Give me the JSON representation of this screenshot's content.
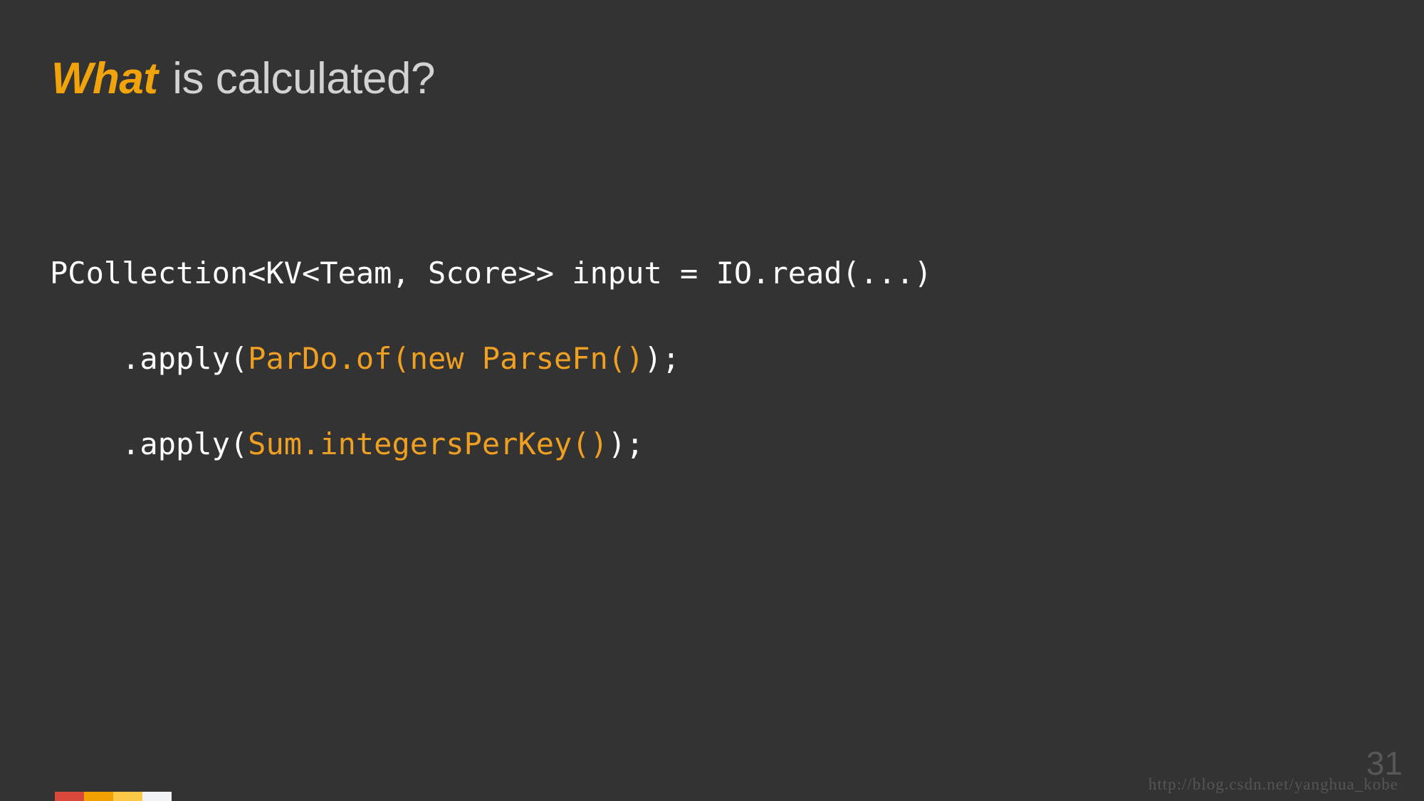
{
  "slide": {
    "background_color": "#333333",
    "title": {
      "accent_text": "What",
      "accent_color": "#F0A30A",
      "rest_text": " is calculated?",
      "rest_color": "#D2D2D2"
    },
    "code": {
      "language": "java",
      "plain_color": "#FFFFFF",
      "call_color": "#F0A020",
      "lines": [
        {
          "segments": [
            {
              "text": "PCollection<KV<Team, Score>> input = IO.read(...)",
              "style": "plain"
            }
          ]
        },
        {
          "segments": [
            {
              "text": "    .apply(",
              "style": "plain"
            },
            {
              "text": "ParDo.of(new ParseFn()",
              "style": "call"
            },
            {
              "text": ");",
              "style": "plain"
            }
          ]
        },
        {
          "segments": [
            {
              "text": "    .apply(",
              "style": "plain"
            },
            {
              "text": "Sum.integersPerKey()",
              "style": "call"
            },
            {
              "text": ");",
              "style": "plain"
            }
          ]
        }
      ]
    },
    "footer": {
      "color_bar": [
        {
          "name": "segment-red",
          "color": "#D9483B"
        },
        {
          "name": "segment-orange",
          "color": "#F0A000"
        },
        {
          "name": "segment-yellow",
          "color": "#FBC947"
        },
        {
          "name": "segment-white",
          "color": "#F1F2F4"
        }
      ],
      "page_number": "31",
      "page_number_color": "#575757",
      "watermark": "http://blog.csdn.net/yanghua_kobe",
      "watermark_color": "#555555"
    }
  }
}
